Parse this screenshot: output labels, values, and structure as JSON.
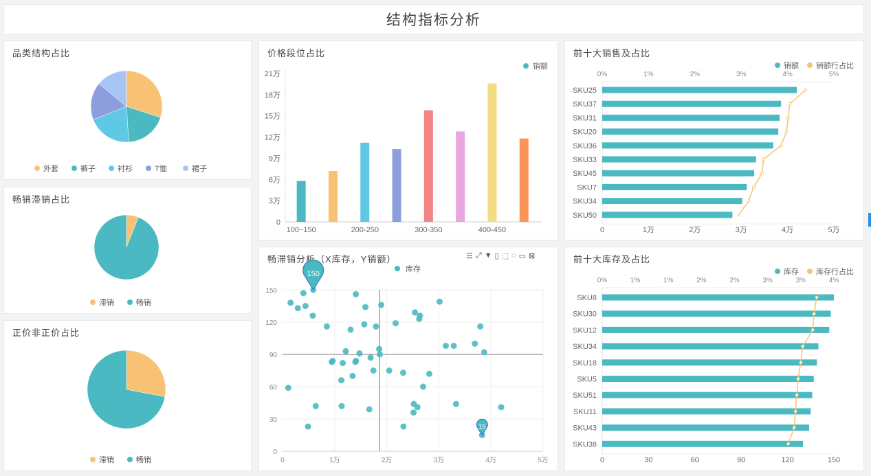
{
  "header": {
    "title": "结构指标分析"
  },
  "colors": {
    "teal": "#4bb9c1",
    "orange": "#f8c275",
    "cyan": "#5ec8e5",
    "indigo": "#8c9fdc",
    "lightblue": "#a8c4f5",
    "red": "#f28585",
    "pink": "#e9a6e1",
    "yellow": "#f3dd84",
    "deeporange": "#fc9456",
    "marker": "#2e6bc6"
  },
  "toolbar_icons": [
    "data-view-icon",
    "line-icon",
    "filter-icon",
    "export-icon",
    "rect-select-icon",
    "lasso-icon",
    "restore-icon",
    "clear-icon"
  ],
  "toolbar_glyphs": [
    "☰",
    "⤢",
    "▼",
    "▯",
    "⬚",
    "◌",
    "▭",
    "⊠"
  ],
  "chart_data": [
    {
      "id": "category",
      "type": "pie",
      "title": "品类结构占比",
      "legend": "bottom",
      "labels": [
        "外套",
        "裤子",
        "衬衫",
        "T恤",
        "裙子"
      ],
      "values": [
        30,
        19,
        20,
        17,
        14
      ],
      "colors": [
        "#f8c275",
        "#4bb9c1",
        "#5ec8e5",
        "#8c9fdc",
        "#a8c4f5"
      ]
    },
    {
      "id": "sellthrough",
      "type": "pie",
      "title": "畅销滞销占比",
      "legend": "bottom",
      "labels": [
        "滞销",
        "畅销"
      ],
      "values": [
        6,
        94
      ],
      "colors": [
        "#f8c275",
        "#4bb9c1"
      ]
    },
    {
      "id": "fullprice",
      "type": "pie",
      "title": "正价非正价占比",
      "legend": "bottom",
      "labels": [
        "滞销",
        "畅销"
      ],
      "values": [
        28,
        72
      ],
      "colors": [
        "#f8c275",
        "#4bb9c1"
      ]
    },
    {
      "id": "pricebands",
      "type": "bar",
      "title": "价格段位占比",
      "legend": [
        "销额"
      ],
      "legend_placement": "top-right",
      "categories": [
        "100~150",
        "",
        "200-250",
        "",
        "300-350",
        "",
        "400-450",
        ""
      ],
      "values": [
        58000,
        72000,
        112000,
        103000,
        158000,
        128000,
        196000,
        118000
      ],
      "colors": [
        "#4bb9c1",
        "#f8c275",
        "#5ec8e5",
        "#8c9fdc",
        "#f28585",
        "#e9a6e1",
        "#f3dd84",
        "#fc9456"
      ],
      "yticks": [
        "0",
        "3万",
        "6万",
        "9万",
        "12万",
        "15万",
        "18万",
        "21万"
      ],
      "ylim": [
        0,
        210000
      ]
    },
    {
      "id": "topsales",
      "type": "bar",
      "orientation": "horizontal",
      "title": "前十大销售及占比",
      "legend": [
        "销额",
        "销额行占比"
      ],
      "legend_placement": "top-right",
      "categories": [
        "SKU25",
        "SKU37",
        "SKU31",
        "SKU20",
        "SKU36",
        "SKU33",
        "SKU45",
        "SKU7",
        "SKU34",
        "SKU50"
      ],
      "values": [
        42000,
        38600,
        38300,
        38000,
        36900,
        33200,
        32800,
        31200,
        30200,
        28100
      ],
      "pct": [
        4.39,
        4.05,
        4.01,
        3.98,
        3.86,
        3.48,
        3.45,
        3.27,
        3.16,
        2.95
      ],
      "xticks": [
        "0",
        "1万",
        "2万",
        "3万",
        "4万",
        "5万"
      ],
      "xlim": [
        0,
        50000
      ],
      "pct_ticks": [
        "0%",
        "1%",
        "2%",
        "3%",
        "4%",
        "5%"
      ],
      "pct_lim": [
        0,
        5
      ]
    },
    {
      "id": "scatter",
      "type": "scatter",
      "title": "畅滞销分析（X库存，Y销额）",
      "legend": [
        "库存"
      ],
      "legend_placement": "top-center",
      "xticks": [
        "0",
        "1万",
        "2万",
        "3万",
        "4万",
        "5万"
      ],
      "yticks": [
        "0",
        "30",
        "60",
        "90",
        "120",
        "150"
      ],
      "xlim": [
        0,
        50000
      ],
      "ylim": [
        0,
        150
      ],
      "markline_x": 18670,
      "markline_y": 90,
      "max_label": "150",
      "min_label": "15",
      "points": [
        [
          5900,
          150
        ],
        [
          4000,
          147
        ],
        [
          1540,
          138
        ],
        [
          2940,
          133
        ],
        [
          4400,
          135
        ],
        [
          5800,
          126
        ],
        [
          8500,
          116
        ],
        [
          14060,
          146
        ],
        [
          15900,
          134
        ],
        [
          18940,
          136
        ],
        [
          15680,
          118
        ],
        [
          17930,
          116
        ],
        [
          13050,
          113
        ],
        [
          21700,
          119
        ],
        [
          25400,
          129
        ],
        [
          26360,
          126
        ],
        [
          26230,
          123
        ],
        [
          30140,
          139
        ],
        [
          31330,
          98
        ],
        [
          32860,
          98
        ],
        [
          36900,
          100
        ],
        [
          37960,
          116
        ],
        [
          38700,
          92
        ],
        [
          12130,
          93
        ],
        [
          14760,
          91
        ],
        [
          16900,
          87
        ],
        [
          18540,
          95
        ],
        [
          18670,
          90
        ],
        [
          9450,
          83
        ],
        [
          9620,
          84
        ],
        [
          11560,
          82
        ],
        [
          13970,
          83
        ],
        [
          14100,
          84
        ],
        [
          17440,
          75
        ],
        [
          20470,
          75
        ],
        [
          23150,
          73
        ],
        [
          28160,
          72
        ],
        [
          13440,
          70
        ],
        [
          11290,
          66
        ],
        [
          26980,
          60
        ],
        [
          1100,
          59
        ],
        [
          6370,
          42
        ],
        [
          11340,
          42
        ],
        [
          16650,
          39
        ],
        [
          25180,
          44
        ],
        [
          25880,
          41
        ],
        [
          25140,
          36
        ],
        [
          33300,
          44
        ],
        [
          41960,
          41
        ],
        [
          4880,
          23
        ],
        [
          23200,
          23
        ],
        [
          38300,
          15
        ]
      ]
    },
    {
      "id": "topstock",
      "type": "bar",
      "orientation": "horizontal",
      "title": "前十大库存及占比",
      "legend": [
        "库存",
        "库存行占比"
      ],
      "legend_placement": "top-right",
      "categories": [
        "SKU8",
        "SKU30",
        "SKU12",
        "SKU34",
        "SKU18",
        "SKU5",
        "SKU51",
        "SKU11",
        "SKU43",
        "SKU38"
      ],
      "values": [
        150,
        148,
        147,
        140,
        139,
        137,
        136,
        135,
        134,
        130
      ],
      "pct": [
        3.24,
        3.2,
        3.18,
        3.03,
        3.0,
        2.96,
        2.94,
        2.92,
        2.9,
        2.81
      ],
      "xticks": [
        "0",
        "30",
        "60",
        "90",
        "120",
        "150"
      ],
      "xlim": [
        0,
        150
      ],
      "pct_ticks": [
        "0%",
        "1%",
        "1%",
        "2%",
        "2%",
        "3%",
        "3%",
        "4%"
      ],
      "pct_lim": [
        0,
        3.5
      ]
    }
  ]
}
